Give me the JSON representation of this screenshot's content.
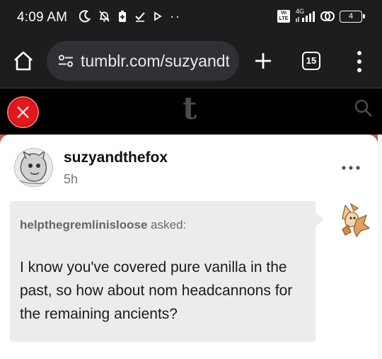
{
  "status_bar": {
    "time": "4:09 AM",
    "volte_badge_lines": [
      "Vo",
      "LTE"
    ],
    "network_type": "4G",
    "battery_level": "4",
    "extra_indicator": "··",
    "icons": [
      "moon-icon",
      "bell-off-icon",
      "battery-saver-icon",
      "checkmark-icon",
      "play-icon",
      "signal-icon",
      "hotspot-icon",
      "battery-icon"
    ]
  },
  "browser": {
    "url": "tumblr.com/suzyandthefox",
    "tab_count": "15",
    "icons": [
      "home-icon",
      "site-settings-icon",
      "new-tab-icon",
      "tabs-icon",
      "overflow-menu-icon"
    ]
  },
  "tumblr_header": {
    "logo": "t",
    "icons": [
      "close-icon",
      "search-icon"
    ],
    "accent_color": "#e3181c"
  },
  "post": {
    "blog_name": "suzyandthefox",
    "time_ago": "5h",
    "asker_name": "helpthegremlinisloose",
    "asked_label": " asked:",
    "question": "I know you've covered pure vanilla in the past, so how about nom headcannons for the remaining ancients?",
    "icons": [
      "more-options-icon"
    ]
  },
  "colors": {
    "backdrop": "#cf5a4e",
    "bubble": "#ececec",
    "browser_chrome": "#1d1d1f"
  }
}
